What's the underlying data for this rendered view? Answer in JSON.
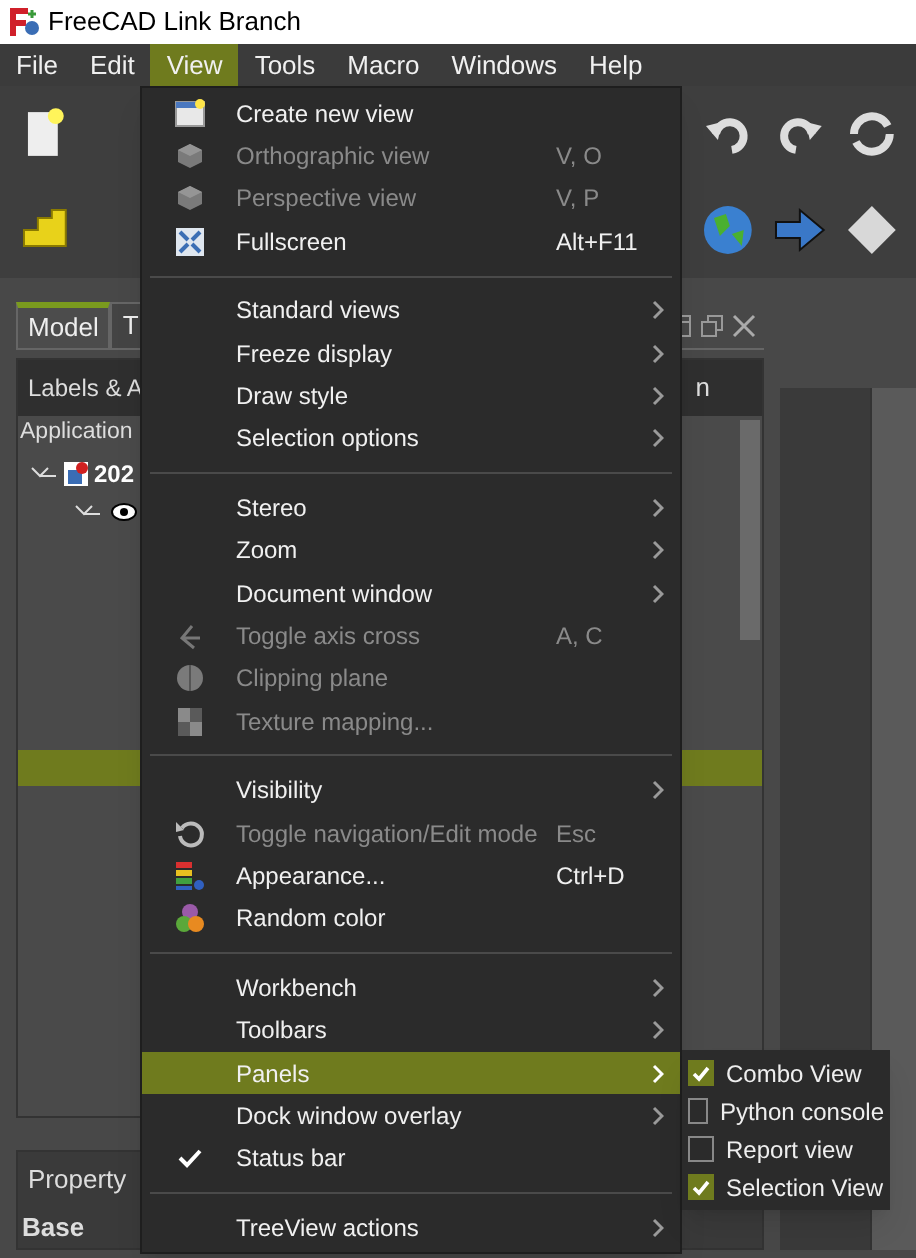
{
  "window": {
    "title": "FreeCAD Link Branch"
  },
  "menu_bar": [
    {
      "label": "File",
      "selected": false
    },
    {
      "label": "Edit",
      "selected": false
    },
    {
      "label": "View",
      "selected": true
    },
    {
      "label": "Tools",
      "selected": false
    },
    {
      "label": "Macro",
      "selected": false
    },
    {
      "label": "Windows",
      "selected": false
    },
    {
      "label": "Help",
      "selected": false
    }
  ],
  "combo_view": {
    "tabs": [
      {
        "label": "Model",
        "selected": true
      },
      {
        "label": "T",
        "selected": false
      }
    ],
    "tree_header": {
      "column_1": "Labels & A",
      "column_2": "n"
    },
    "tree": [
      {
        "label": "Application",
        "children": [
          {
            "label": "202"
          }
        ]
      }
    ],
    "property_header": "Property",
    "property_group": "Base"
  },
  "view_menu": {
    "sections": [
      {
        "items": [
          {
            "label": "Create new view",
            "disabled": false,
            "submenu": false,
            "checked": false,
            "selected": false
          },
          {
            "label": "Orthographic view",
            "shortcut": "V, O",
            "disabled": true,
            "submenu": false,
            "checked": false,
            "selected": false
          },
          {
            "label": "Perspective view",
            "shortcut": "V, P",
            "disabled": true,
            "submenu": false,
            "checked": false,
            "selected": false
          },
          {
            "label": "Fullscreen",
            "shortcut": "Alt+F11",
            "disabled": false,
            "submenu": false,
            "checked": false,
            "selected": false
          }
        ]
      },
      {
        "items": [
          {
            "label": "Standard views",
            "disabled": false,
            "submenu": true,
            "checked": false,
            "selected": false
          },
          {
            "label": "Freeze display",
            "disabled": false,
            "submenu": true,
            "checked": false,
            "selected": false
          },
          {
            "label": "Draw style",
            "disabled": false,
            "submenu": true,
            "checked": false,
            "selected": false
          },
          {
            "label": "Selection options",
            "disabled": false,
            "submenu": true,
            "checked": false,
            "selected": false
          }
        ]
      },
      {
        "items": [
          {
            "label": "Stereo",
            "disabled": false,
            "submenu": true,
            "checked": false,
            "selected": false
          },
          {
            "label": "Zoom",
            "disabled": false,
            "submenu": true,
            "checked": false,
            "selected": false
          },
          {
            "label": "Document window",
            "disabled": false,
            "submenu": true,
            "checked": false,
            "selected": false
          },
          {
            "label": "Toggle axis cross",
            "shortcut": "A, C",
            "disabled": true,
            "submenu": false,
            "checked": false,
            "selected": false
          },
          {
            "label": "Clipping plane",
            "disabled": true,
            "submenu": false,
            "checked": false,
            "selected": false
          },
          {
            "label": "Texture mapping...",
            "disabled": true,
            "submenu": false,
            "checked": false,
            "selected": false
          }
        ]
      },
      {
        "items": [
          {
            "label": "Visibility",
            "disabled": false,
            "submenu": true,
            "checked": false,
            "selected": false
          },
          {
            "label": "Toggle navigation/Edit mode",
            "shortcut": "Esc",
            "disabled": true,
            "submenu": false,
            "checked": false,
            "selected": false
          },
          {
            "label": "Appearance...",
            "shortcut": "Ctrl+D",
            "disabled": false,
            "submenu": false,
            "checked": false,
            "selected": false
          },
          {
            "label": "Random color",
            "disabled": false,
            "submenu": false,
            "checked": false,
            "selected": false
          }
        ]
      },
      {
        "items": [
          {
            "label": "Workbench",
            "disabled": false,
            "submenu": true,
            "checked": false,
            "selected": false
          },
          {
            "label": "Toolbars",
            "disabled": false,
            "submenu": true,
            "checked": false,
            "selected": false
          },
          {
            "label": "Panels",
            "disabled": false,
            "submenu": true,
            "checked": false,
            "selected": true
          },
          {
            "label": "Dock window overlay",
            "disabled": false,
            "submenu": true,
            "checked": false,
            "selected": false
          },
          {
            "label": "Status bar",
            "disabled": false,
            "submenu": false,
            "checked": true,
            "selected": false
          }
        ]
      },
      {
        "items": [
          {
            "label": "TreeView actions",
            "disabled": false,
            "submenu": true,
            "checked": false,
            "selected": false
          }
        ]
      }
    ]
  },
  "panels_submenu": [
    {
      "label": "Combo View",
      "checked": true
    },
    {
      "label": "Python console",
      "checked": false
    },
    {
      "label": "Report view",
      "checked": false
    },
    {
      "label": "Selection View",
      "checked": true
    }
  ]
}
